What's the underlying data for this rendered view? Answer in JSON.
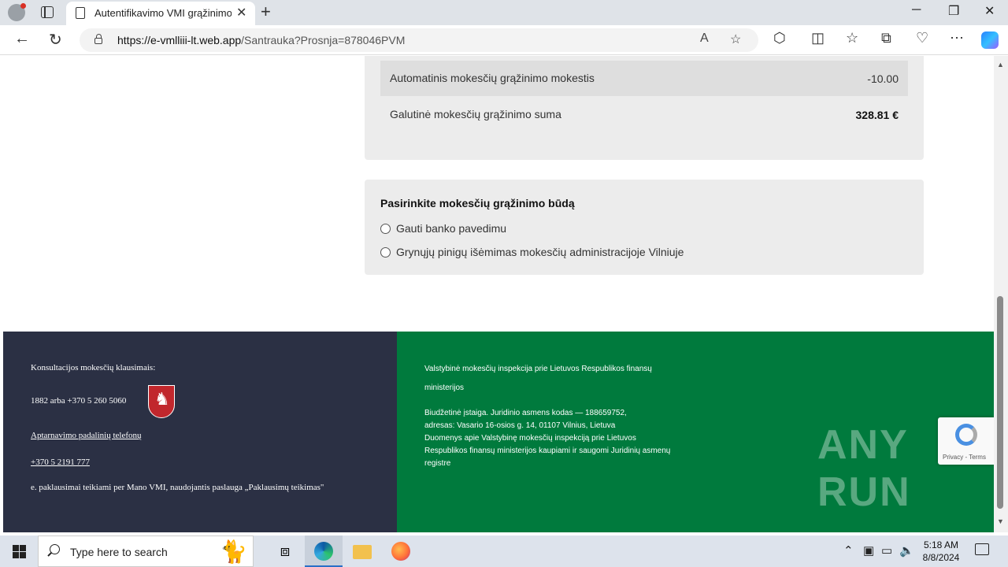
{
  "browser": {
    "tab_title": "Autentifikavimo VMI grąžinimo s",
    "url_host": "https://e-vmlliii-lt.web.app",
    "url_path": "/Santrauka?Prosnja=878046PVM",
    "new_tab": "+",
    "close_tab": "✕"
  },
  "summary": {
    "fee_label": "Automatinis mokesčių grąžinimo mokestis",
    "fee_value": "-10.00",
    "total_label": "Galutinė mokesčių grąžinimo suma",
    "total_value": "328.81 €"
  },
  "method": {
    "title": "Pasirinkite mokesčių grąžinimo būdą",
    "options": [
      {
        "label": "Gauti banko pavedimu"
      },
      {
        "label": "Grynųjų pinigų išėmimas mokesčių administracijoje Vilniuje"
      }
    ]
  },
  "footer": {
    "consult_label": "Konsultacijos mokesčių klausimais:",
    "phone_main": "1882 arba +370 5 260 5060",
    "service_link": "Aptarnavimo padalinių telefonų",
    "phone_link": "+370 5 2191 777",
    "email_note": "e. paklausimai teikiami per Mano VMI, naudojantis paslauga  „Paklausimų teikimas\"",
    "org_name_1": "Valstybinė mokesčių inspekcija prie Lietuvos Respublikos finansų",
    "org_name_2": "ministerijos",
    "info_1": "Biudžetinė įstaiga. Juridinio asmens kodas — 188659752,",
    "info_2": "adresas: Vasario 16-osios g. 14, 01107 Vilnius, Lietuva",
    "info_3": "Duomenys apie Valstybinę mokesčių inspekciją prie Lietuvos",
    "info_4": "Respublikos finansų ministerijos kaupiami ir saugomi Juridinių asmenų",
    "info_5": "registre"
  },
  "recaptcha": {
    "terms": "Privacy - Terms"
  },
  "watermark": "ANY RUN",
  "taskbar": {
    "search_placeholder": "Type here to search",
    "time": "5:18 AM",
    "date": "8/8/2024"
  }
}
